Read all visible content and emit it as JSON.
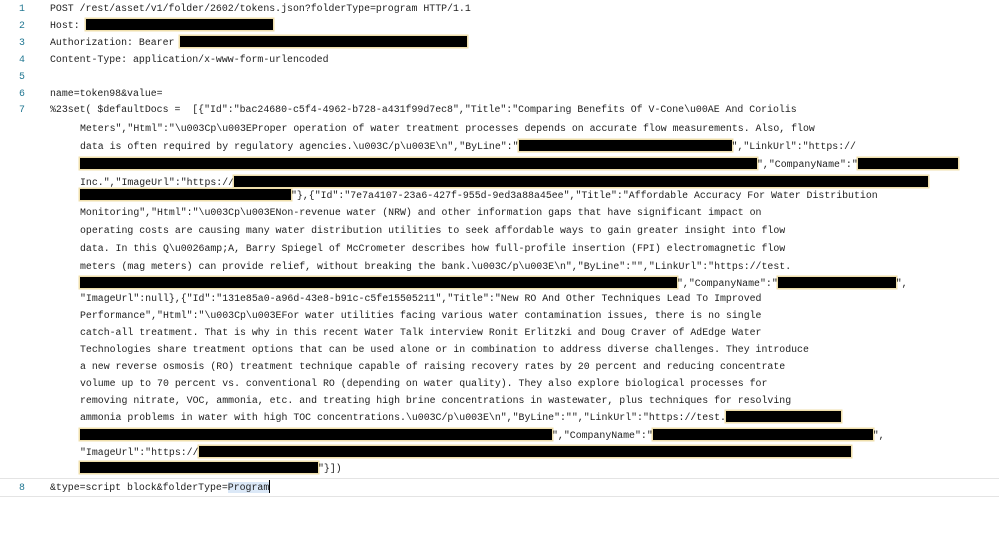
{
  "editor": {
    "line_numbers": [
      "1",
      "2",
      "3",
      "4",
      "5",
      "6",
      "7",
      "8"
    ],
    "line1": "POST /rest/asset/v1/folder/2602/tokens.json?folderType=program HTTP/1.1",
    "line2": "Host: ",
    "line3": "Authorization: Bearer ",
    "line4": "Content-Type: application/x-www-form-urlencoded",
    "line6": "name=token98&value=",
    "line7": [
      [
        "%23set( $defaultDocs =  [{\"Id\":\"bac24680-c5f4-4962-b728-a431f99d7ec8\",\"Title\":\"Comparing Benefits Of V-Cone\\u00AE And Coriolis"
      ],
      [
        "Meters\",\"Html\":\"\\u003Cp\\u003EProper operation of water treatment processes depends on accurate flow measurements. Also, flow"
      ],
      [
        "data is often required by regulatory agencies.\\u003C/p\\u003E\\n\",\"ByLine\":\"",
        "\",\"LinkUrl\":\"https://"
      ],
      [
        "\",\"CompanyName\":\""
      ],
      [
        "Inc.\",\"ImageUrl\":\"https://"
      ],
      [
        "\"},{\"Id\":\"7e7a4107-23a6-427f-955d-9ed3a88a45ee\",\"Title\":\"Affordable Accuracy For Water Distribution"
      ],
      [
        "Monitoring\",\"Html\":\"\\u003Cp\\u003ENon-revenue water (NRW) and other information gaps that have significant impact on"
      ],
      [
        "operating costs are causing many water distribution utilities to seek affordable ways to gain greater insight into flow"
      ],
      [
        "data. In this Q\\u0026amp;A, Barry Spiegel of McCrometer describes how full-profile insertion (FPI) electromagnetic flow"
      ],
      [
        "meters (mag meters) can provide relief, without breaking the bank.\\u003C/p\\u003E\\n\",\"ByLine\":\"\",\"LinkUrl\":\"https://test."
      ],
      [
        "\",\"CompanyName\":\"",
        "\","
      ],
      [
        "\"ImageUrl\":null},{\"Id\":\"131e85a0-a96d-43e8-b91c-c5fe15505211\",\"Title\":\"New RO And Other Techniques Lead To Improved"
      ],
      [
        "Performance\",\"Html\":\"\\u003Cp\\u003EFor water utilities facing various water contamination issues, there is no single"
      ],
      [
        "catch-all treatment. That is why in this recent Water Talk interview Ronit Erlitzki and Doug Craver of AdEdge Water"
      ],
      [
        "Technologies share treatment options that can be used alone or in combination to address diverse challenges. They introduce"
      ],
      [
        "a new reverse osmosis (RO) treatment technique capable of raising recovery rates by 20 percent and reducing concentrate"
      ],
      [
        "volume up to 70 percent vs. conventional RO (depending on water quality). They also explore biological processes for"
      ],
      [
        "removing nitrate, VOC, ammonia, etc. and treating high brine concentrations in wastewater, plus techniques for resolving"
      ],
      [
        "ammonia problems in water with high TOC concentrations.\\u003C/p\\u003E\\n\",\"ByLine\":\"\",\"LinkUrl\":\"https://test."
      ],
      [
        "\",\"CompanyName\":\"",
        "\","
      ],
      [
        "\"ImageUrl\":\"https://"
      ],
      [
        "\"}])"
      ]
    ],
    "line8": {
      "before": "&type=script block&folderType=",
      "selected": "Program"
    }
  }
}
